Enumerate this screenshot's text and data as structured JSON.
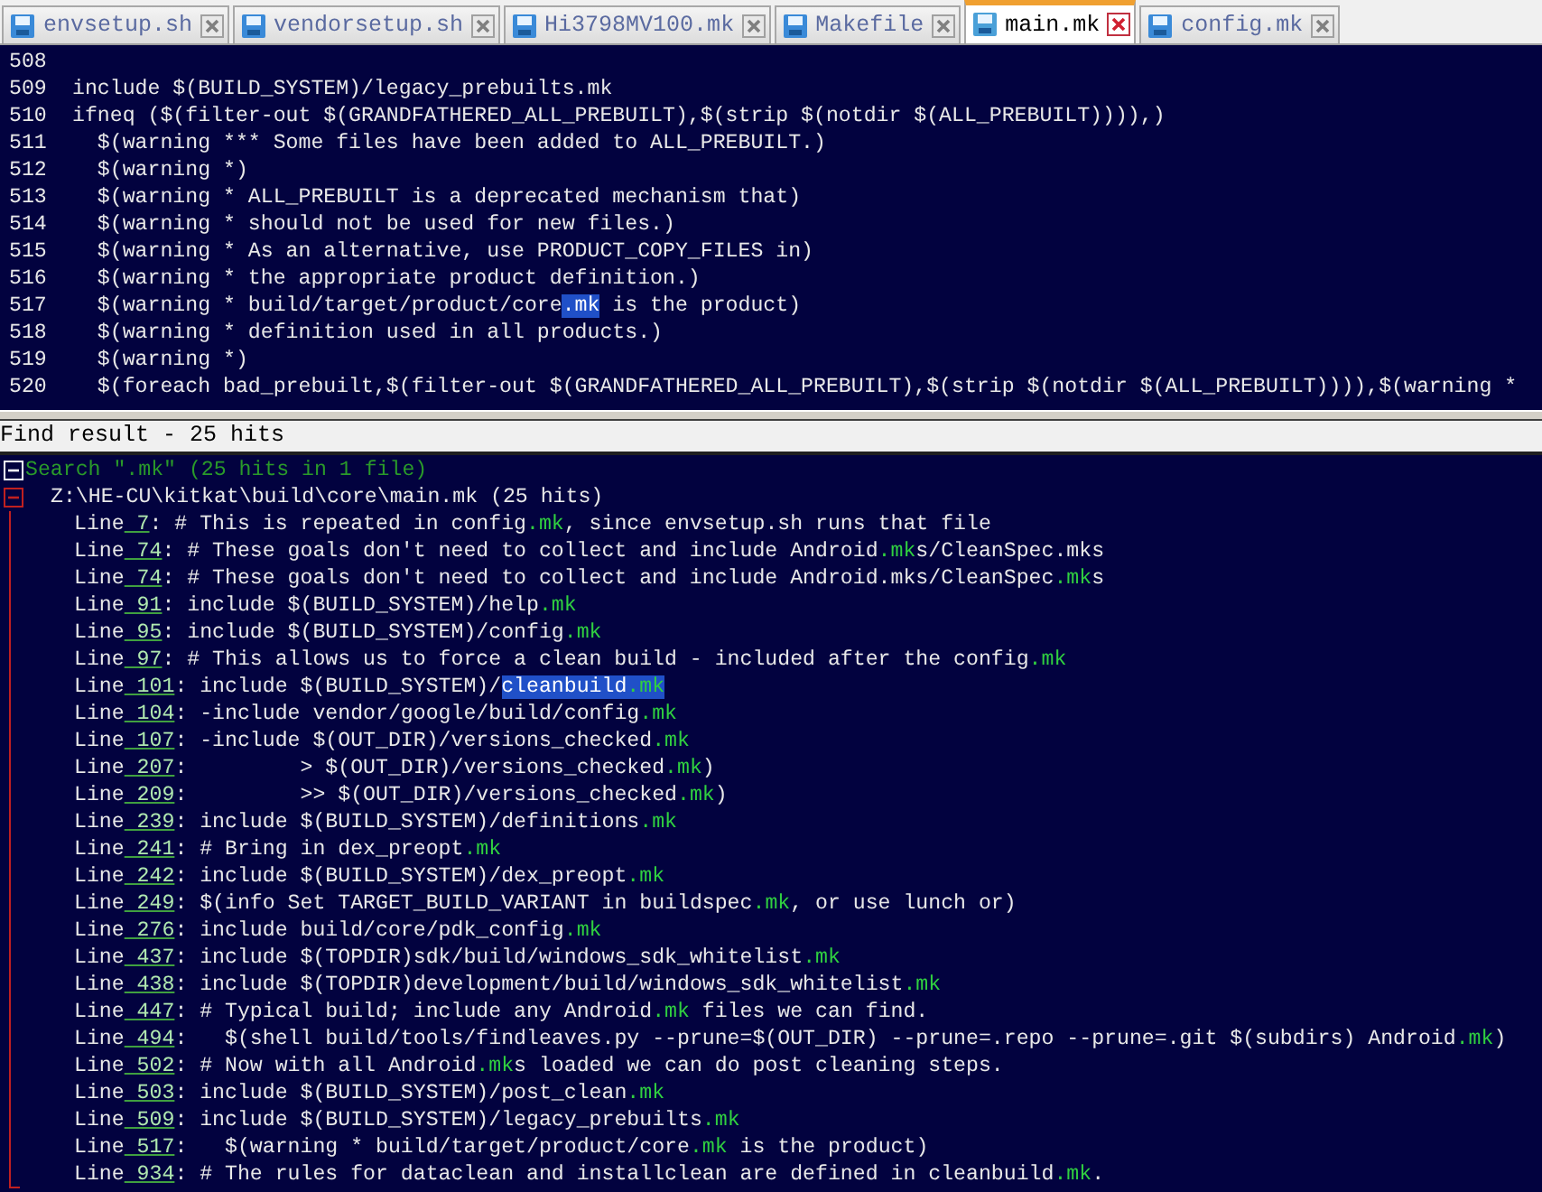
{
  "tabs": [
    {
      "label": "envsetup.sh",
      "selected": false
    },
    {
      "label": "vendorsetup.sh",
      "selected": false
    },
    {
      "label": "Hi3798MV100.mk",
      "selected": false
    },
    {
      "label": "Makefile",
      "selected": false
    },
    {
      "label": "main.mk",
      "selected": true
    },
    {
      "label": "config.mk",
      "selected": false
    }
  ],
  "editor": {
    "lines": [
      {
        "number": "508"
      },
      {
        "number": "509",
        "text": "include $(BUILD_SYSTEM)/legacy_prebuilts.mk"
      },
      {
        "number": "510",
        "text": "ifneq ($(filter-out $(GRANDFATHERED_ALL_PREBUILT),$(strip $(notdir $(ALL_PREBUILT)))),)"
      },
      {
        "number": "511",
        "text": "  $(warning *** Some files have been added to ALL_PREBUILT.)"
      },
      {
        "number": "512",
        "text": "  $(warning *)"
      },
      {
        "number": "513",
        "text": "  $(warning * ALL_PREBUILT is a deprecated mechanism that)"
      },
      {
        "number": "514",
        "text": "  $(warning * should not be used for new files.)"
      },
      {
        "number": "515",
        "text": "  $(warning * As an alternative, use PRODUCT_COPY_FILES in)"
      },
      {
        "number": "516",
        "text": "  $(warning * the appropriate product definition.)"
      },
      {
        "number": "517",
        "parts": [
          {
            "text": "  $(warning * build/target/product/core",
            "kind": "plain"
          },
          {
            "text": ".mk",
            "kind": "selected"
          },
          {
            "text": " is the product)",
            "kind": "plain"
          }
        ]
      },
      {
        "number": "518",
        "text": "  $(warning * definition used in all products.)"
      },
      {
        "number": "519",
        "text": "  $(warning *)"
      },
      {
        "number": "520",
        "text": "  $(foreach bad_prebuilt,$(filter-out $(GRANDFATHERED_ALL_PREBUILT),$(strip $(notdir $(ALL_PREBUILT)))),$(warning *"
      }
    ]
  },
  "find_results": {
    "title": "Find result - 25 hits",
    "search": {
      "label": "Search \".mk\" (25 hits in 1 file)",
      "expanded": true
    },
    "file": {
      "label": "Z:\\HE-CU\\kitkat\\build\\core\\main.mk (25 hits)",
      "expanded": true
    },
    "hits": [
      {
        "prefix": "Line",
        "line": "7",
        "parts": [
          {
            "text": ": # This is repeated in config",
            "kind": "plain"
          },
          {
            "text": ".mk",
            "kind": "match"
          },
          {
            "text": ", since envsetup.sh runs that file",
            "kind": "plain"
          }
        ]
      },
      {
        "prefix": "Line",
        "line": "74",
        "parts": [
          {
            "text": ": # These goals don't need to collect and include Android",
            "kind": "plain"
          },
          {
            "text": ".mk",
            "kind": "match"
          },
          {
            "text": "s/CleanSpec.mks",
            "kind": "plain"
          }
        ]
      },
      {
        "prefix": "Line",
        "line": "74",
        "parts": [
          {
            "text": ": # These goals don't need to collect and include Android.mks/CleanSpec",
            "kind": "plain"
          },
          {
            "text": ".mk",
            "kind": "match"
          },
          {
            "text": "s",
            "kind": "plain"
          }
        ]
      },
      {
        "prefix": "Line",
        "line": "91",
        "parts": [
          {
            "text": ": include $(BUILD_SYSTEM)/help",
            "kind": "plain"
          },
          {
            "text": ".mk",
            "kind": "match"
          }
        ]
      },
      {
        "prefix": "Line",
        "line": "95",
        "parts": [
          {
            "text": ": include $(BUILD_SYSTEM)/config",
            "kind": "plain"
          },
          {
            "text": ".mk",
            "kind": "match"
          }
        ]
      },
      {
        "prefix": "Line",
        "line": "97",
        "parts": [
          {
            "text": ": # This allows us to force a clean build - included after the config",
            "kind": "plain"
          },
          {
            "text": ".mk",
            "kind": "match"
          }
        ]
      },
      {
        "prefix": "Line",
        "line": "101",
        "parts": [
          {
            "text": ": include $(BUILD_SYSTEM)/",
            "kind": "plain"
          },
          {
            "text": "cleanbuild",
            "kind": "selected"
          },
          {
            "text": ".mk",
            "kind": "selected-match"
          }
        ]
      },
      {
        "prefix": "Line",
        "line": "104",
        "parts": [
          {
            "text": ": -include vendor/google/build/config",
            "kind": "plain"
          },
          {
            "text": ".mk",
            "kind": "match"
          }
        ]
      },
      {
        "prefix": "Line",
        "line": "107",
        "parts": [
          {
            "text": ": -include $(OUT_DIR)/versions_checked",
            "kind": "plain"
          },
          {
            "text": ".mk",
            "kind": "match"
          }
        ]
      },
      {
        "prefix": "Line",
        "line": "207",
        "parts": [
          {
            "text": ":         > $(OUT_DIR)/versions_checked",
            "kind": "plain"
          },
          {
            "text": ".mk",
            "kind": "match"
          },
          {
            "text": ")",
            "kind": "plain"
          }
        ]
      },
      {
        "prefix": "Line",
        "line": "209",
        "parts": [
          {
            "text": ":         >> $(OUT_DIR)/versions_checked",
            "kind": "plain"
          },
          {
            "text": ".mk",
            "kind": "match"
          },
          {
            "text": ")",
            "kind": "plain"
          }
        ]
      },
      {
        "prefix": "Line",
        "line": "239",
        "parts": [
          {
            "text": ": include $(BUILD_SYSTEM)/definitions",
            "kind": "plain"
          },
          {
            "text": ".mk",
            "kind": "match"
          }
        ]
      },
      {
        "prefix": "Line",
        "line": "241",
        "parts": [
          {
            "text": ": # Bring in dex_preopt",
            "kind": "plain"
          },
          {
            "text": ".mk",
            "kind": "match"
          }
        ]
      },
      {
        "prefix": "Line",
        "line": "242",
        "parts": [
          {
            "text": ": include $(BUILD_SYSTEM)/dex_preopt",
            "kind": "plain"
          },
          {
            "text": ".mk",
            "kind": "match"
          }
        ]
      },
      {
        "prefix": "Line",
        "line": "249",
        "parts": [
          {
            "text": ": $(info Set TARGET_BUILD_VARIANT in buildspec",
            "kind": "plain"
          },
          {
            "text": ".mk",
            "kind": "match"
          },
          {
            "text": ", or use lunch or)",
            "kind": "plain"
          }
        ]
      },
      {
        "prefix": "Line",
        "line": "276",
        "parts": [
          {
            "text": ": include build/core/pdk_config",
            "kind": "plain"
          },
          {
            "text": ".mk",
            "kind": "match"
          }
        ]
      },
      {
        "prefix": "Line",
        "line": "437",
        "parts": [
          {
            "text": ": include $(TOPDIR)sdk/build/windows_sdk_whitelist",
            "kind": "plain"
          },
          {
            "text": ".mk",
            "kind": "match"
          }
        ]
      },
      {
        "prefix": "Line",
        "line": "438",
        "parts": [
          {
            "text": ": include $(TOPDIR)development/build/windows_sdk_whitelist",
            "kind": "plain"
          },
          {
            "text": ".mk",
            "kind": "match"
          }
        ]
      },
      {
        "prefix": "Line",
        "line": "447",
        "parts": [
          {
            "text": ": # Typical build; include any Android",
            "kind": "plain"
          },
          {
            "text": ".mk",
            "kind": "match"
          },
          {
            "text": " files we can find.",
            "kind": "plain"
          }
        ]
      },
      {
        "prefix": "Line",
        "line": "494",
        "parts": [
          {
            "text": ":   $(shell build/tools/findleaves.py --prune=$(OUT_DIR) --prune=.repo --prune=.git $(subdirs) Android",
            "kind": "plain"
          },
          {
            "text": ".mk",
            "kind": "match"
          },
          {
            "text": ")",
            "kind": "plain"
          }
        ]
      },
      {
        "prefix": "Line",
        "line": "502",
        "parts": [
          {
            "text": ": # Now with all Android",
            "kind": "plain"
          },
          {
            "text": ".mk",
            "kind": "match"
          },
          {
            "text": "s loaded we can do post cleaning steps.",
            "kind": "plain"
          }
        ]
      },
      {
        "prefix": "Line",
        "line": "503",
        "parts": [
          {
            "text": ": include $(BUILD_SYSTEM)/post_clean",
            "kind": "plain"
          },
          {
            "text": ".mk",
            "kind": "match"
          }
        ]
      },
      {
        "prefix": "Line",
        "line": "509",
        "parts": [
          {
            "text": ": include $(BUILD_SYSTEM)/legacy_prebuilts",
            "kind": "plain"
          },
          {
            "text": ".mk",
            "kind": "match"
          }
        ]
      },
      {
        "prefix": "Line",
        "line": "517",
        "parts": [
          {
            "text": ":   $(warning * build/target/product/core",
            "kind": "plain"
          },
          {
            "text": ".mk",
            "kind": "match"
          },
          {
            "text": " is the product)",
            "kind": "plain"
          }
        ]
      },
      {
        "prefix": "Line",
        "line": "934",
        "parts": [
          {
            "text": ": # The rules for dataclean and installclean are defined in cleanbuild",
            "kind": "plain"
          },
          {
            "text": ".mk",
            "kind": "match"
          },
          {
            "text": ".",
            "kind": "plain"
          }
        ]
      }
    ]
  }
}
